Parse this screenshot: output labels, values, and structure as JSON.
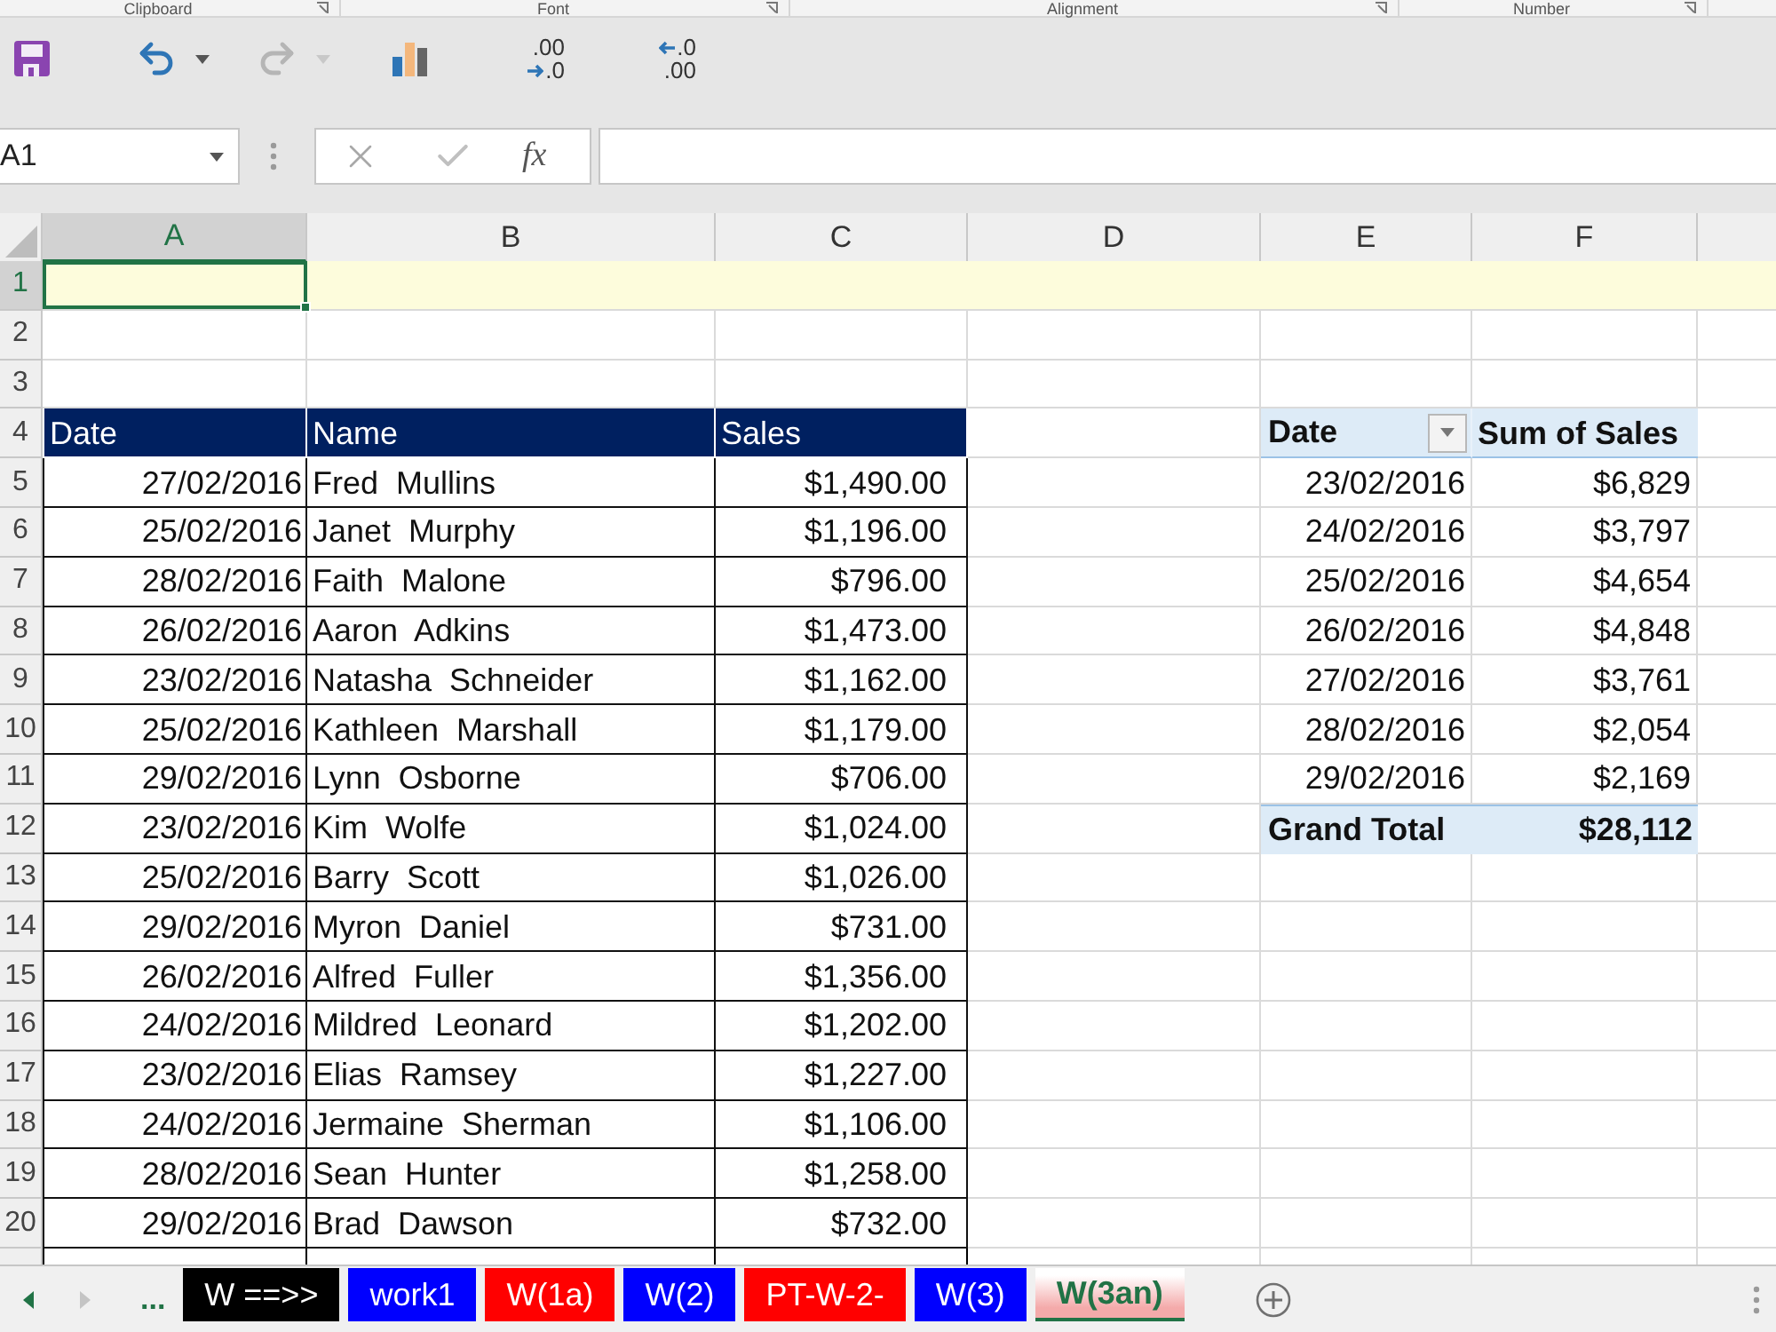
{
  "ribbon_groups": [
    {
      "label": "Clipboard"
    },
    {
      "label": "Font"
    },
    {
      "label": "Alignment"
    },
    {
      "label": "Number"
    }
  ],
  "quick_access": [
    {
      "kind": "save",
      "disabled": false
    },
    {
      "kind": "undo",
      "disabled": false
    },
    {
      "kind": "redo",
      "disabled": true
    },
    {
      "kind": "chart",
      "disabled": false
    },
    {
      "kind": "increase_decimal",
      "disabled": false,
      "top": ".00",
      "bottom": ".0"
    },
    {
      "kind": "decrease_decimal",
      "disabled": false,
      "top": ".0",
      "bottom": ".00"
    }
  ],
  "formula_bar": {
    "name_box": "A1",
    "function_label": "fx"
  },
  "sheet": {
    "columns": [
      {
        "label": "A",
        "selected": true
      },
      {
        "label": "B",
        "selected": false
      },
      {
        "label": "C",
        "selected": false
      },
      {
        "label": "D",
        "selected": false
      },
      {
        "label": "E",
        "selected": false
      },
      {
        "label": "F",
        "selected": false
      }
    ],
    "rows": [
      {
        "label": "1",
        "selected": true,
        "highlighted": true
      },
      {
        "label": "2",
        "selected": false,
        "highlighted": false
      },
      {
        "label": "3",
        "selected": false,
        "highlighted": false
      },
      {
        "label": "4",
        "selected": false,
        "highlighted": false
      },
      {
        "label": "5",
        "selected": false,
        "highlighted": false
      },
      {
        "label": "6",
        "selected": false,
        "highlighted": false
      },
      {
        "label": "7",
        "selected": false,
        "highlighted": false
      },
      {
        "label": "8",
        "selected": false,
        "highlighted": false
      },
      {
        "label": "9",
        "selected": false,
        "highlighted": false
      },
      {
        "label": "10",
        "selected": false,
        "highlighted": false
      },
      {
        "label": "11",
        "selected": false,
        "highlighted": false
      },
      {
        "label": "12",
        "selected": false,
        "highlighted": false
      },
      {
        "label": "13",
        "selected": false,
        "highlighted": false
      },
      {
        "label": "14",
        "selected": false,
        "highlighted": false
      },
      {
        "label": "15",
        "selected": false,
        "highlighted": false
      },
      {
        "label": "16",
        "selected": false,
        "highlighted": false
      },
      {
        "label": "17",
        "selected": false,
        "highlighted": false
      },
      {
        "label": "18",
        "selected": false,
        "highlighted": false
      },
      {
        "label": "19",
        "selected": false,
        "highlighted": false
      },
      {
        "label": "20",
        "selected": false,
        "highlighted": false
      }
    ]
  },
  "table": {
    "columns": [
      "Date",
      "Name",
      "Sales"
    ],
    "rows": [
      {
        "date": "27/02/2016",
        "name": "Fred  Mullins",
        "sales": "$1,490.00"
      },
      {
        "date": "25/02/2016",
        "name": "Janet  Murphy",
        "sales": "$1,196.00"
      },
      {
        "date": "28/02/2016",
        "name": "Faith  Malone",
        "sales": "$796.00"
      },
      {
        "date": "26/02/2016",
        "name": "Aaron  Adkins",
        "sales": "$1,473.00"
      },
      {
        "date": "23/02/2016",
        "name": "Natasha  Schneider",
        "sales": "$1,162.00"
      },
      {
        "date": "25/02/2016",
        "name": "Kathleen  Marshall",
        "sales": "$1,179.00"
      },
      {
        "date": "29/02/2016",
        "name": "Lynn  Osborne",
        "sales": "$706.00"
      },
      {
        "date": "23/02/2016",
        "name": "Kim  Wolfe",
        "sales": "$1,024.00"
      },
      {
        "date": "25/02/2016",
        "name": "Barry  Scott",
        "sales": "$1,026.00"
      },
      {
        "date": "29/02/2016",
        "name": "Myron  Daniel",
        "sales": "$731.00"
      },
      {
        "date": "26/02/2016",
        "name": "Alfred  Fuller",
        "sales": "$1,356.00"
      },
      {
        "date": "24/02/2016",
        "name": "Mildred  Leonard",
        "sales": "$1,202.00"
      },
      {
        "date": "23/02/2016",
        "name": "Elias  Ramsey",
        "sales": "$1,227.00"
      },
      {
        "date": "24/02/2016",
        "name": "Jermaine  Sherman",
        "sales": "$1,106.00"
      },
      {
        "date": "28/02/2016",
        "name": "Sean  Hunter",
        "sales": "$1,258.00"
      },
      {
        "date": "29/02/2016",
        "name": "Brad  Dawson",
        "sales": "$732.00"
      }
    ]
  },
  "pivot": {
    "columns": [
      "Date",
      "Sum of Sales"
    ],
    "rows": [
      {
        "date": "23/02/2016",
        "sum": "$6,829"
      },
      {
        "date": "24/02/2016",
        "sum": "$3,797"
      },
      {
        "date": "25/02/2016",
        "sum": "$4,654"
      },
      {
        "date": "26/02/2016",
        "sum": "$4,848"
      },
      {
        "date": "27/02/2016",
        "sum": "$3,761"
      },
      {
        "date": "28/02/2016",
        "sum": "$2,054"
      },
      {
        "date": "29/02/2016",
        "sum": "$2,169"
      }
    ],
    "total": {
      "label": "Grand Total",
      "value": "$28,112"
    }
  },
  "sheet_tabs": {
    "more_label": "...",
    "tabs": [
      {
        "label": "W ==>>",
        "color": "#000000",
        "selected": false
      },
      {
        "label": "work1",
        "color": "#0000ff",
        "selected": false
      },
      {
        "label": "W(1a)",
        "color": "#ff0000",
        "selected": false
      },
      {
        "label": "W(2)",
        "color": "#0000ff",
        "selected": false
      },
      {
        "label": "PT-W-2-",
        "color": "#ff0000",
        "selected": false
      },
      {
        "label": "W(3)",
        "color": "#0000ff",
        "selected": false
      },
      {
        "label": "W(3an)",
        "color": "#f4aaaa",
        "selected": true
      }
    ]
  }
}
